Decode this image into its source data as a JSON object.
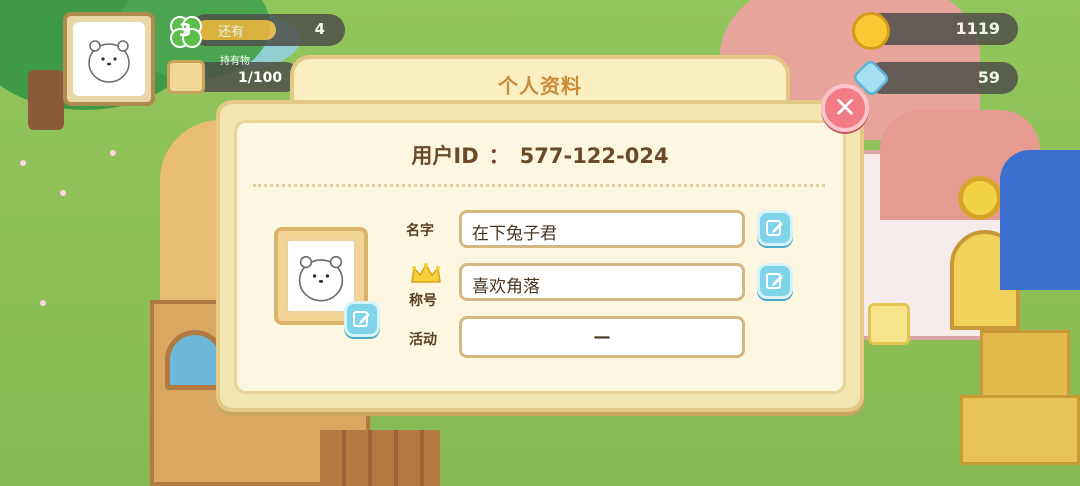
{
  "hud": {
    "level": "3",
    "stock_label": "还有",
    "stock_value": "4",
    "items_caption": "持有物",
    "items_value": "1/100",
    "coins": "1119",
    "gems": "59"
  },
  "dialog": {
    "title": "个人资料",
    "uid_label": "用户ID",
    "uid_sep": "：",
    "uid_value": "577-122-024",
    "name_label": "名字",
    "name_value": "在下兔子君",
    "title_label": "称号",
    "title_value": "喜欢角落",
    "activity_label": "活动",
    "activity_value": "—"
  },
  "icons": {
    "close": "close-icon",
    "edit": "edit-icon",
    "crown": "crown-icon",
    "coin": "coin-icon",
    "gem": "gem-icon",
    "clover": "clover-icon"
  },
  "colors": {
    "dialog_bg": "#f4e6b0",
    "title_text": "#c98c3a",
    "close_button": "#f27c85",
    "edit_button": "#7fd4ea"
  }
}
